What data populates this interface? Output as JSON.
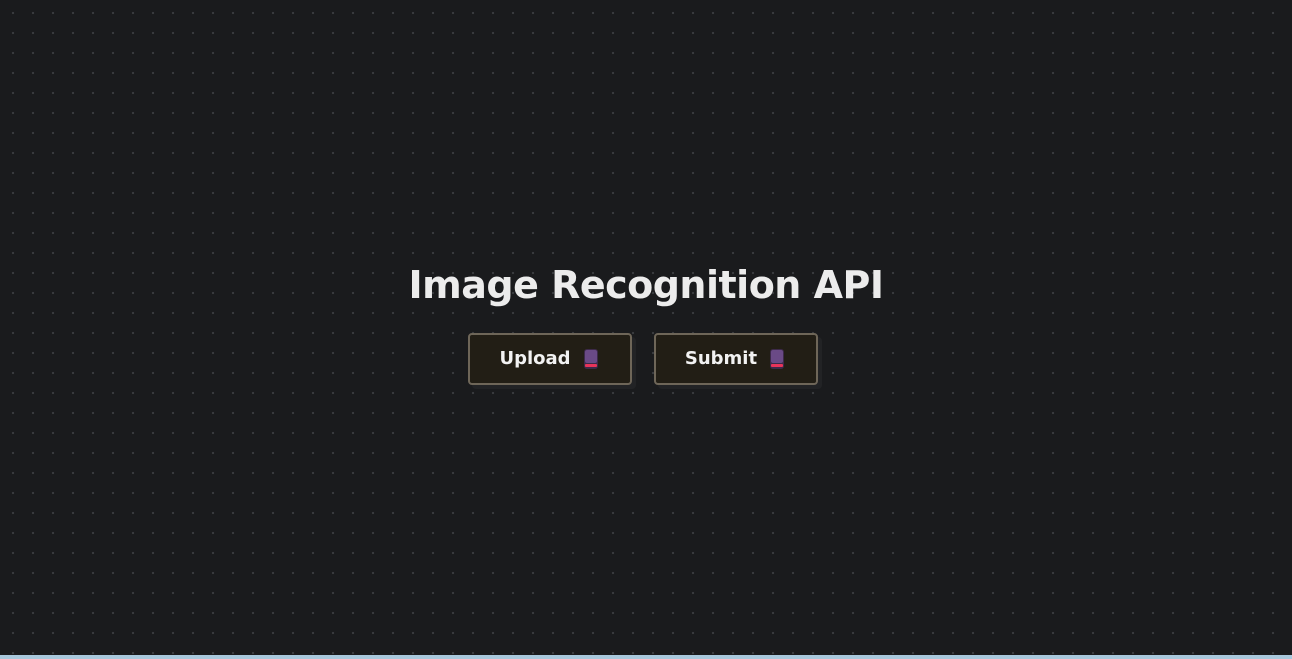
{
  "page": {
    "title": "Image Recognition API"
  },
  "actions": {
    "upload_label": "Upload",
    "submit_label": "Submit",
    "button_icon": "book-icon"
  },
  "colors": {
    "background": "#1a1b1d",
    "dot": "#3a3c3f",
    "title_text": "#ececec",
    "button_bg": "#221e15",
    "button_border": "#6e6658",
    "icon_body": "#5a3a6e",
    "icon_accent": "#e8345a",
    "bottom_bar": "#a9c8dc"
  }
}
